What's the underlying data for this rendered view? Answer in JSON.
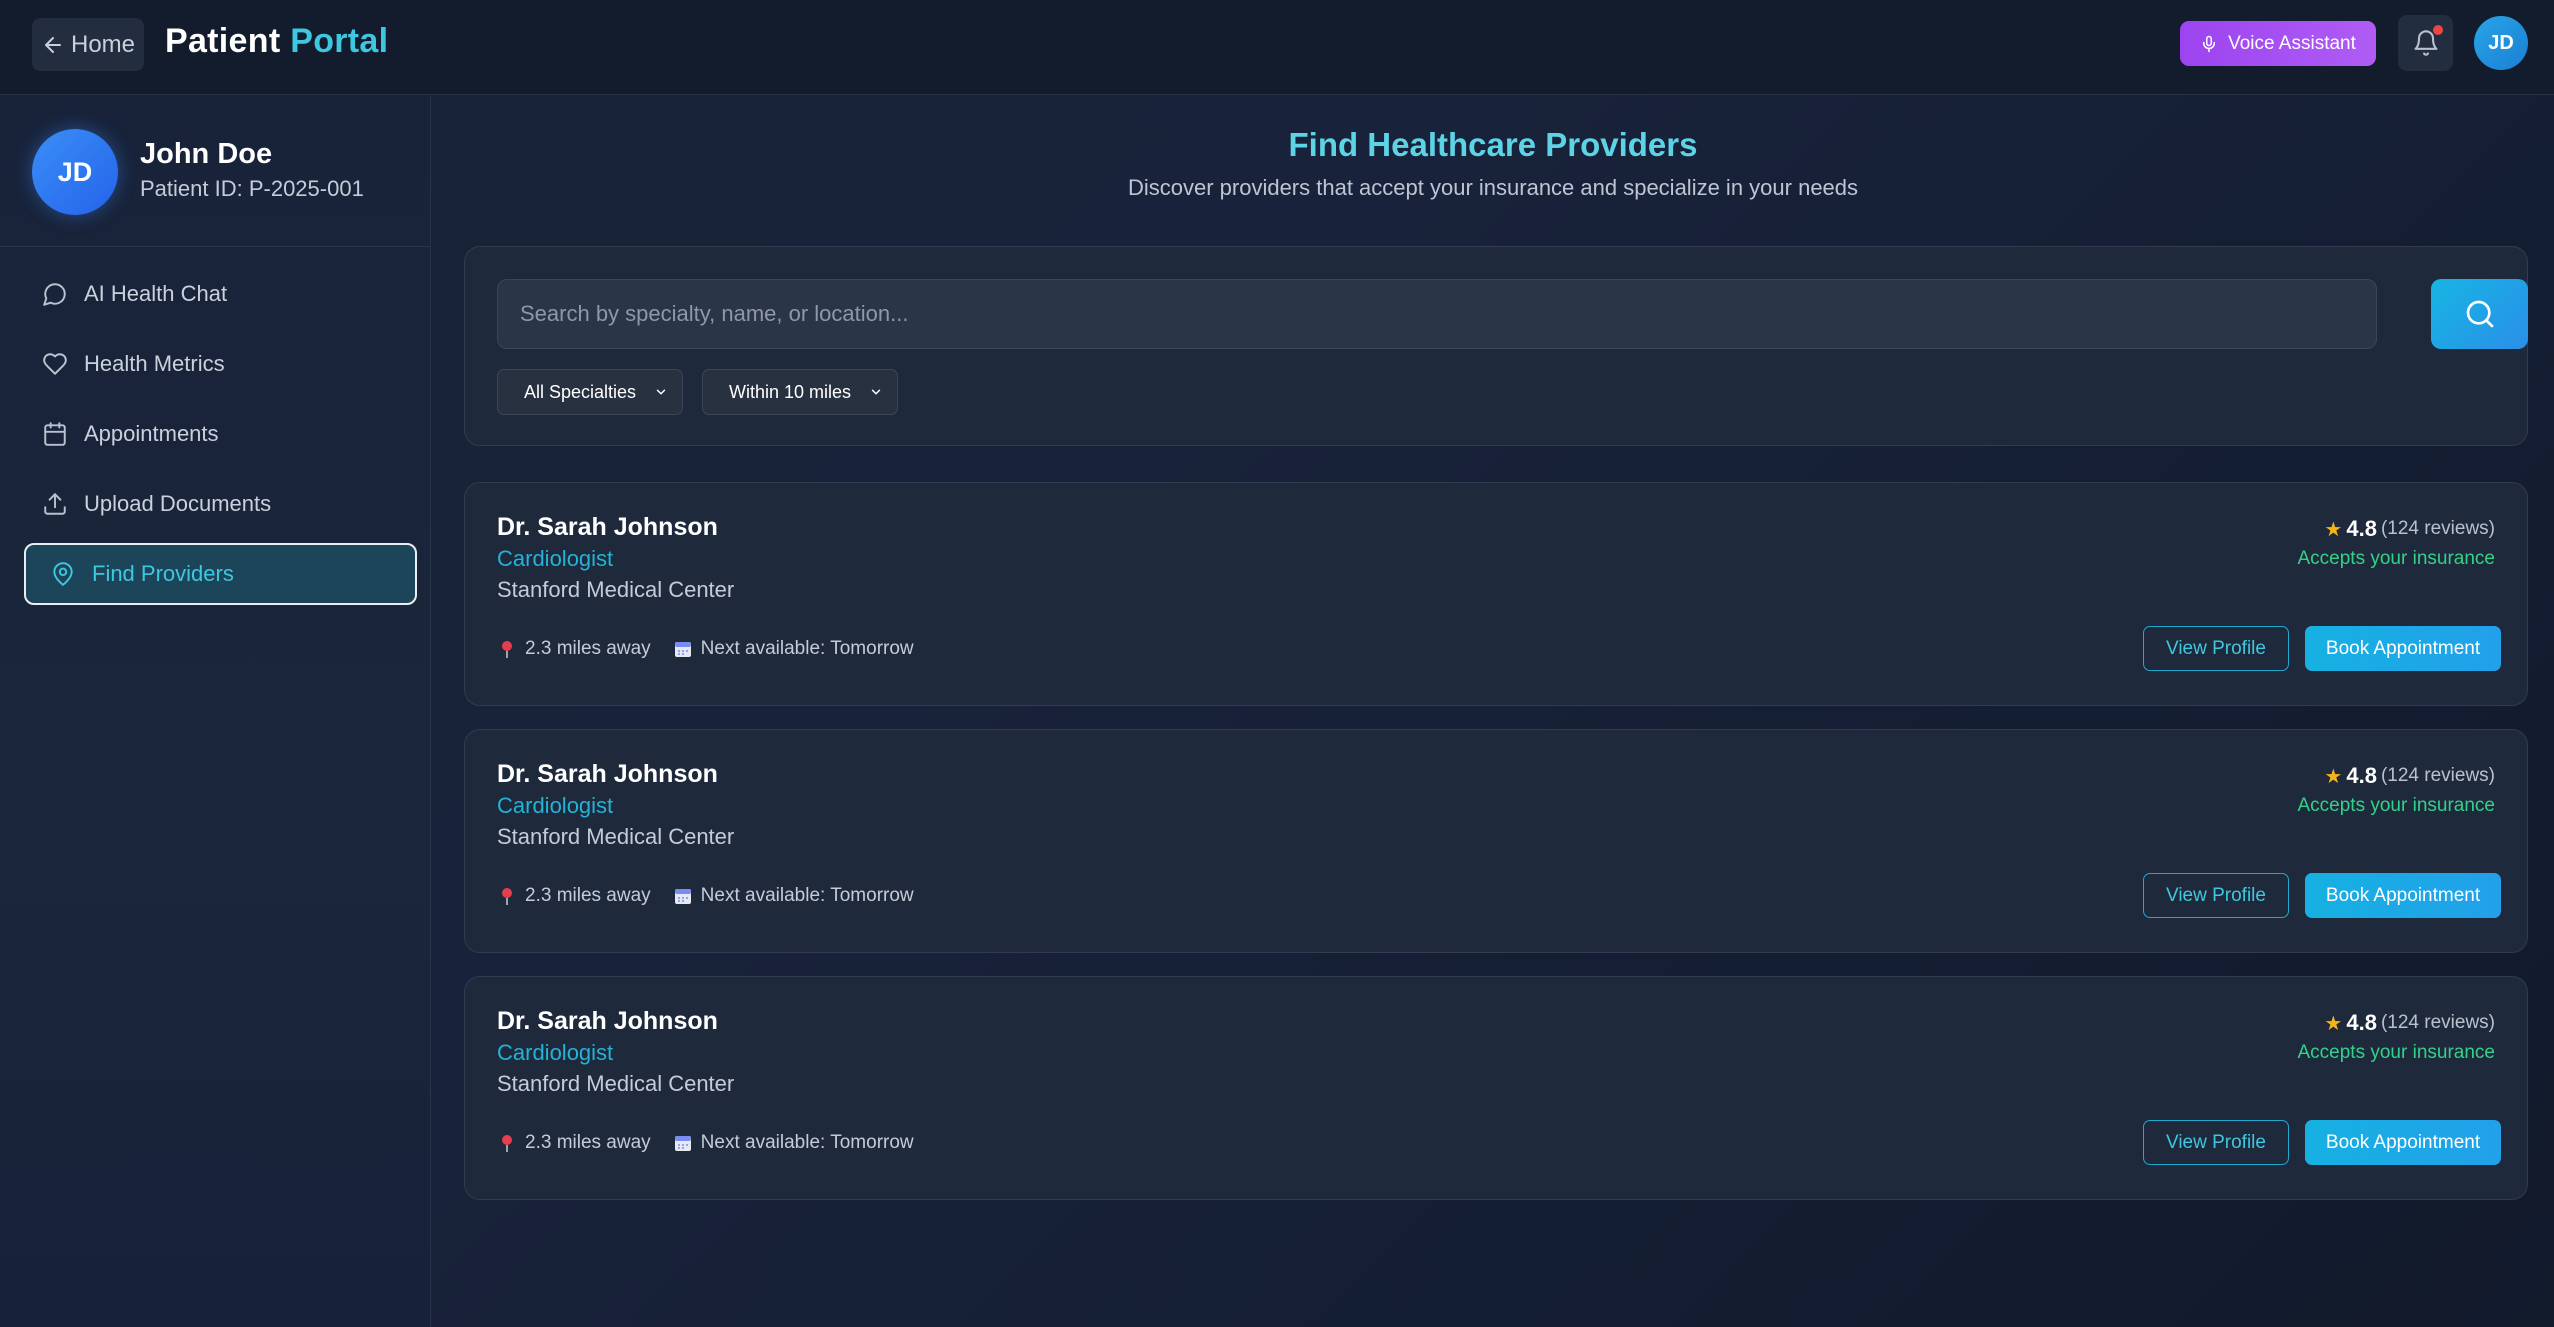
{
  "header": {
    "home_label": "Home",
    "brand_main": "Patient",
    "brand_accent": "Portal",
    "voice_label": "Voice Assistant",
    "avatar_initials": "JD",
    "notification_dot": true
  },
  "sidebar": {
    "profile": {
      "initials": "JD",
      "name": "John Doe",
      "patient_id": "Patient ID: P-2025-001"
    },
    "items": [
      {
        "label": "AI Health Chat",
        "icon": "chat-bubble-icon"
      },
      {
        "label": "Health Metrics",
        "icon": "heart-icon"
      },
      {
        "label": "Appointments",
        "icon": "calendar-icon"
      },
      {
        "label": "Upload Documents",
        "icon": "upload-icon"
      },
      {
        "label": "Find Providers",
        "icon": "map-pin-icon",
        "active": true
      }
    ]
  },
  "main": {
    "title": "Find Healthcare Providers",
    "subtitle": "Discover providers that accept your insurance and specialize in your needs",
    "search": {
      "placeholder": "Search by specialty, name, or location...",
      "value": ""
    },
    "filters": {
      "specialty": "All Specialties",
      "distance": "Within 10 miles"
    },
    "providers": [
      {
        "name": "Dr. Sarah Johnson",
        "specialty": "Cardiologist",
        "center": "Stanford Medical Center",
        "distance": "2.3 miles away",
        "availability": "Next available: Tomorrow",
        "rating": "4.8",
        "reviews": "(124 reviews)",
        "insurance": "Accepts your insurance",
        "view_label": "View Profile",
        "book_label": "Book Appointment"
      },
      {
        "name": "Dr. Sarah Johnson",
        "specialty": "Cardiologist",
        "center": "Stanford Medical Center",
        "distance": "2.3 miles away",
        "availability": "Next available: Tomorrow",
        "rating": "4.8",
        "reviews": "(124 reviews)",
        "insurance": "Accepts your insurance",
        "view_label": "View Profile",
        "book_label": "Book Appointment"
      },
      {
        "name": "Dr. Sarah Johnson",
        "specialty": "Cardiologist",
        "center": "Stanford Medical Center",
        "distance": "2.3 miles away",
        "availability": "Next available: Tomorrow",
        "rating": "4.8",
        "reviews": "(124 reviews)",
        "insurance": "Accepts your insurance",
        "view_label": "View Profile",
        "book_label": "Book Appointment"
      }
    ]
  },
  "colors": {
    "accent": "#3ec7e0",
    "voice_button": "#a24cf2",
    "insurance_green": "#34d18a",
    "star": "#f5b51a",
    "background": "#18223a"
  }
}
